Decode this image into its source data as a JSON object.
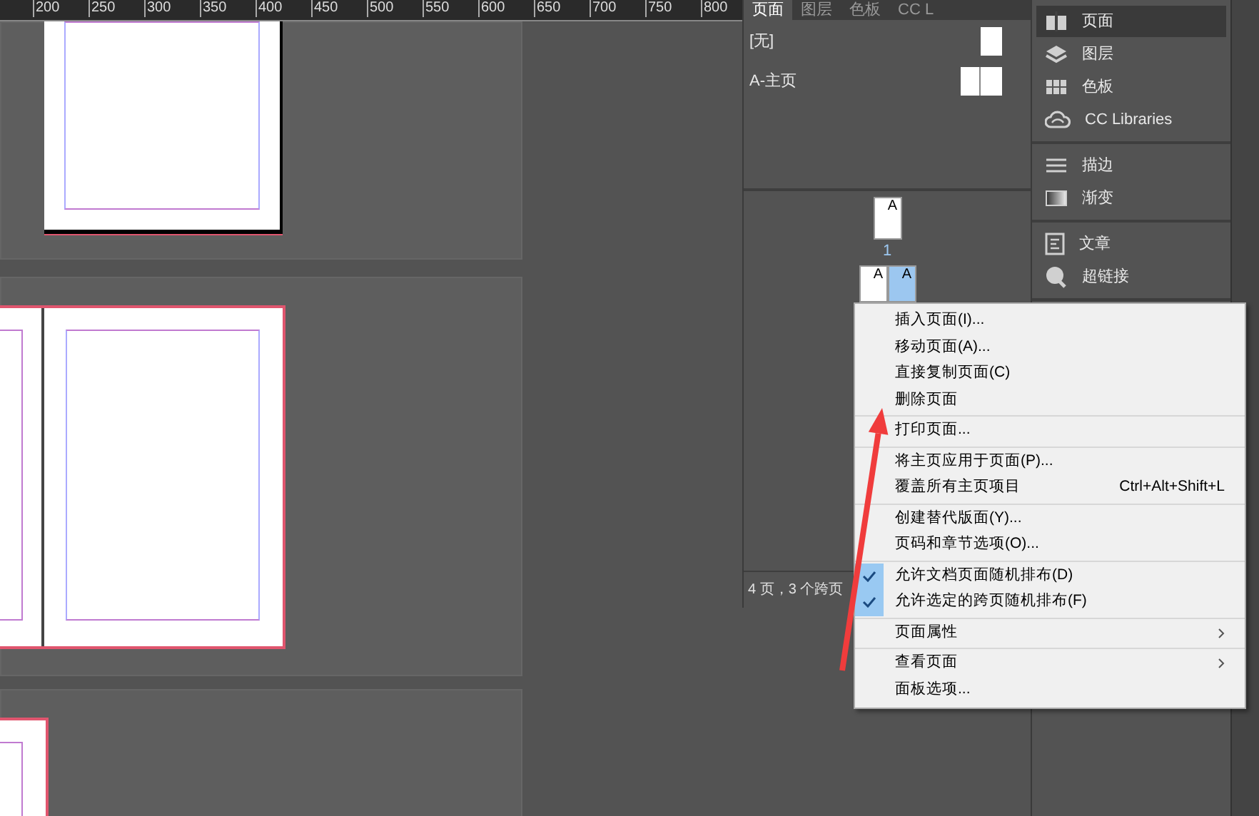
{
  "ruler": {
    "labels": [
      "200",
      "250",
      "300",
      "350",
      "400",
      "450",
      "500",
      "550",
      "600",
      "650",
      "700",
      "750",
      "800"
    ]
  },
  "pages_panel": {
    "tabs": [
      {
        "label": "页面",
        "selected": true
      },
      {
        "label": "图层",
        "selected": false
      },
      {
        "label": "色板",
        "selected": false
      },
      {
        "label": "CC L",
        "selected": false
      }
    ],
    "masters": [
      {
        "label": "[无]",
        "kind": "single"
      },
      {
        "label": "A-主页",
        "kind": "spread"
      }
    ],
    "pages": [
      {
        "kind": "single",
        "prefixes": [
          {
            "label": "A",
            "selected": false
          }
        ],
        "number": "1"
      },
      {
        "kind": "spread",
        "prefixes": [
          {
            "label": "A",
            "selected": false
          },
          {
            "label": "A",
            "selected": true
          }
        ]
      }
    ],
    "status": "4 页，3 个跨页"
  },
  "dock": {
    "groups": [
      [
        {
          "label": "页面",
          "kind": "pages",
          "selected": true
        },
        {
          "label": "图层",
          "kind": "layers",
          "selected": false
        },
        {
          "label": "色板",
          "kind": "swatches",
          "selected": false
        },
        {
          "label": "CC Libraries",
          "kind": "cloud",
          "selected": false
        }
      ],
      [
        {
          "label": "描边",
          "kind": "stroke",
          "selected": false
        },
        {
          "label": "渐变",
          "kind": "gradient",
          "selected": false
        }
      ],
      [
        {
          "label": "文章",
          "kind": "story",
          "selected": false
        },
        {
          "label": "超链接",
          "kind": "link",
          "selected": false
        }
      ]
    ]
  },
  "context_menu": {
    "groups": [
      [
        {
          "label": "插入页面(I)...",
          "checked": false,
          "submenu": false
        },
        {
          "label": "移动页面(A)...",
          "checked": false,
          "submenu": false
        },
        {
          "label": "直接复制页面(C)",
          "checked": false,
          "submenu": false
        },
        {
          "label": "删除页面",
          "checked": false,
          "submenu": false
        }
      ],
      [
        {
          "label": "打印页面...",
          "checked": false,
          "submenu": false
        }
      ],
      [
        {
          "label": "将主页应用于页面(P)...",
          "checked": false,
          "submenu": false
        },
        {
          "label": "覆盖所有主页项目",
          "shortcut": "Ctrl+Alt+Shift+L",
          "checked": false,
          "submenu": false
        }
      ],
      [
        {
          "label": "创建替代版面(Y)...",
          "checked": false,
          "submenu": false
        },
        {
          "label": "页码和章节选项(O)...",
          "checked": false,
          "submenu": false
        }
      ],
      [
        {
          "label": "允许文档页面随机排布(D)",
          "checked": true,
          "submenu": false
        },
        {
          "label": "允许选定的跨页随机排布(F)",
          "checked": true,
          "submenu": false
        }
      ],
      [
        {
          "label": "页面属性",
          "checked": false,
          "submenu": true
        }
      ],
      [
        {
          "label": "查看页面",
          "checked": false,
          "submenu": true
        },
        {
          "label": "面板选项...",
          "checked": false,
          "submenu": false
        }
      ]
    ]
  }
}
